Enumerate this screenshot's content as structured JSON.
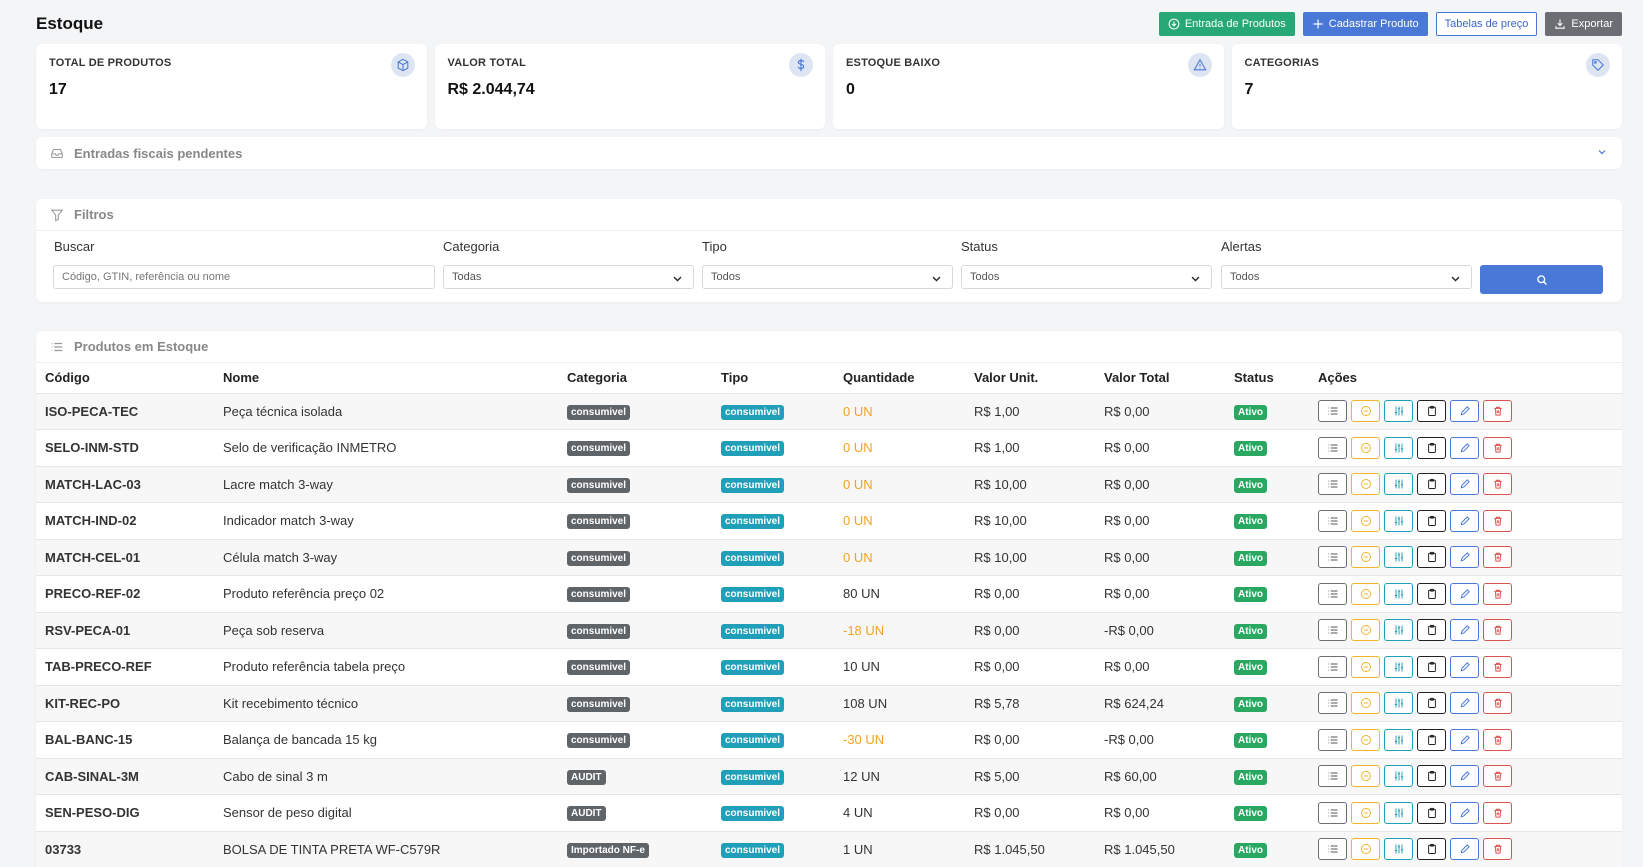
{
  "header": {
    "title": "Estoque",
    "actions": {
      "entrada": "Entrada de Produtos",
      "cadastrar": "Cadastrar Produto",
      "tabelas": "Tabelas de preço",
      "exportar": "Exportar"
    }
  },
  "stats": [
    {
      "label": "TOTAL DE PRODUTOS",
      "value": "17",
      "icon": "box-icon"
    },
    {
      "label": "VALOR TOTAL",
      "value": "R$ 2.044,74",
      "icon": "dollar-icon"
    },
    {
      "label": "ESTOQUE BAIXO",
      "value": "0",
      "icon": "warning-icon"
    },
    {
      "label": "CATEGORIAS",
      "value": "7",
      "icon": "tag-icon"
    }
  ],
  "pending": {
    "title": "Entradas fiscais pendentes"
  },
  "filters": {
    "title": "Filtros",
    "buscar_label": "Buscar",
    "buscar_placeholder": "Código, GTIN, referência ou nome",
    "categoria_label": "Categoria",
    "categoria_value": "Todas",
    "tipo_label": "Tipo",
    "tipo_value": "Todos",
    "status_label": "Status",
    "status_value": "Todos",
    "alertas_label": "Alertas",
    "alertas_value": "Todos"
  },
  "products": {
    "title": "Produtos em Estoque",
    "columns": [
      "Código",
      "Nome",
      "Categoria",
      "Tipo",
      "Quantidade",
      "Valor Unit.",
      "Valor Total",
      "Status",
      "Ações"
    ],
    "rows": [
      {
        "code": "ISO-PECA-TEC",
        "name": "Peça técnica isolada",
        "category": "consumivel",
        "type": "consumivel",
        "qty": "0 UN",
        "warn": true,
        "unit": "R$ 1,00",
        "total": "R$ 0,00",
        "status": "Ativo"
      },
      {
        "code": "SELO-INM-STD",
        "name": "Selo de verificação INMETRO",
        "category": "consumivel",
        "type": "consumivel",
        "qty": "0 UN",
        "warn": true,
        "unit": "R$ 1,00",
        "total": "R$ 0,00",
        "status": "Ativo"
      },
      {
        "code": "MATCH-LAC-03",
        "name": "Lacre match 3-way",
        "category": "consumivel",
        "type": "consumivel",
        "qty": "0 UN",
        "warn": true,
        "unit": "R$ 10,00",
        "total": "R$ 0,00",
        "status": "Ativo"
      },
      {
        "code": "MATCH-IND-02",
        "name": "Indicador match 3-way",
        "category": "consumivel",
        "type": "consumivel",
        "qty": "0 UN",
        "warn": true,
        "unit": "R$ 10,00",
        "total": "R$ 0,00",
        "status": "Ativo"
      },
      {
        "code": "MATCH-CEL-01",
        "name": "Célula match 3-way",
        "category": "consumivel",
        "type": "consumivel",
        "qty": "0 UN",
        "warn": true,
        "unit": "R$ 10,00",
        "total": "R$ 0,00",
        "status": "Ativo"
      },
      {
        "code": "PRECO-REF-02",
        "name": "Produto referência preço 02",
        "category": "consumivel",
        "type": "consumivel",
        "qty": "80 UN",
        "warn": false,
        "unit": "R$ 0,00",
        "total": "R$ 0,00",
        "status": "Ativo"
      },
      {
        "code": "RSV-PECA-01",
        "name": "Peça sob reserva",
        "category": "consumivel",
        "type": "consumivel",
        "qty": "-18 UN",
        "warn": true,
        "unit": "R$ 0,00",
        "total": "-R$ 0,00",
        "status": "Ativo"
      },
      {
        "code": "TAB-PRECO-REF",
        "name": "Produto referência tabela preço",
        "category": "consumivel",
        "type": "consumivel",
        "qty": "10 UN",
        "warn": false,
        "unit": "R$ 0,00",
        "total": "R$ 0,00",
        "status": "Ativo"
      },
      {
        "code": "KIT-REC-PO",
        "name": "Kit recebimento técnico",
        "category": "consumivel",
        "type": "consumivel",
        "qty": "108 UN",
        "warn": false,
        "unit": "R$ 5,78",
        "total": "R$ 624,24",
        "status": "Ativo"
      },
      {
        "code": "BAL-BANC-15",
        "name": "Balança de bancada 15 kg",
        "category": "consumivel",
        "type": "consumivel",
        "qty": "-30 UN",
        "warn": true,
        "unit": "R$ 0,00",
        "total": "-R$ 0,00",
        "status": "Ativo"
      },
      {
        "code": "CAB-SINAL-3M",
        "name": "Cabo de sinal 3 m",
        "category": "AUDIT",
        "type": "consumivel",
        "qty": "12 UN",
        "warn": false,
        "unit": "R$ 5,00",
        "total": "R$ 60,00",
        "status": "Ativo"
      },
      {
        "code": "SEN-PESO-DIG",
        "name": "Sensor de peso digital",
        "category": "AUDIT",
        "type": "consumivel",
        "qty": "4 UN",
        "warn": false,
        "unit": "R$ 0,00",
        "total": "R$ 0,00",
        "status": "Ativo"
      },
      {
        "code": "03733",
        "name": "BOLSA DE TINTA PRETA WF-C579R",
        "category": "Importado NF-e",
        "type": "consumivel",
        "qty": "1 UN",
        "warn": false,
        "unit": "R$ 1.045,50",
        "total": "R$ 1.045,50",
        "status": "Ativo"
      }
    ]
  }
}
